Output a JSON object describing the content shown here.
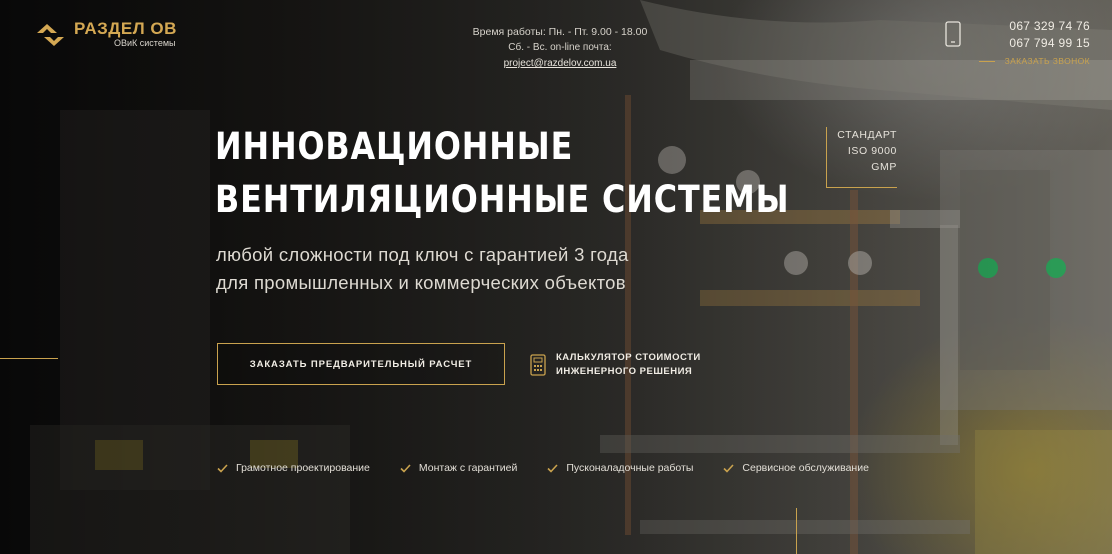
{
  "brand": {
    "name": "РАЗДЕЛ ОВ",
    "tagline": "ОВиК системы"
  },
  "header": {
    "hours_line1": "Время работы: Пн. - Пт. 9.00 - 18.00",
    "hours_line2_prefix": "Сб. - Вс. on-line почта:",
    "email": "project@razdelov.com.ua",
    "phones": [
      "067 329 74 76",
      "067 794 99 15"
    ],
    "callback_label": "ЗАКАЗАТЬ ЗВОНОК"
  },
  "hero": {
    "headline_line1": "ИННОВАЦИОННЫЕ",
    "headline_line2": "ВЕНТИЛЯЦИОННЫЕ СИСТЕМЫ",
    "subline_line1": "любой сложности под ключ с гарантией 3 года",
    "subline_line2": "для промышленных и коммерческих объектов"
  },
  "badge": {
    "line1": "СТАНДАРТ",
    "line2": "ISO 9000",
    "line3": "GMP"
  },
  "actions": {
    "cta_label": "ЗАКАЗАТЬ ПРЕДВАРИТЕЛЬНЫЙ РАСЧЕТ",
    "calc_line1": "КАЛЬКУЛЯТОР СТОИМОСТИ",
    "calc_line2": "ИНЖЕНЕРНОГО РЕШЕНИЯ"
  },
  "features": [
    {
      "label": "Грамотное проектирование"
    },
    {
      "label": "Монтаж с гарантией"
    },
    {
      "label": "Пусконаладочные работы"
    },
    {
      "label": "Сервисное обслуживание"
    }
  ],
  "colors": {
    "accent": "#c9a24e",
    "text": "#ffffff"
  },
  "icons": {
    "logo": "logo-mark-icon",
    "phone": "phone-icon",
    "calculator": "calculator-icon",
    "check": "check-icon"
  }
}
